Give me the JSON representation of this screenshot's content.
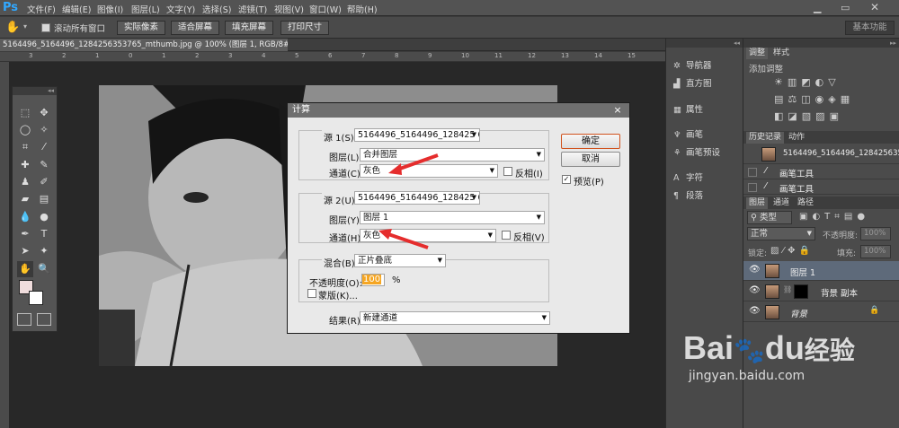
{
  "menubar": {
    "logo": "Ps",
    "items": [
      "文件(F)",
      "编辑(E)",
      "图像(I)",
      "图层(L)",
      "文字(Y)",
      "选择(S)",
      "滤镜(T)",
      "视图(V)",
      "窗口(W)",
      "帮助(H)"
    ]
  },
  "options": {
    "scroll_all": "滚动所有窗口",
    "buttons": [
      "实际像素",
      "适合屏幕",
      "填充屏幕",
      "打印尺寸"
    ],
    "workspace": "基本功能"
  },
  "document": {
    "tab": "5164496_5164496_1284256353765_mthumb.jpg @ 100% (图层 1, RGB/8#) *",
    "close": "×"
  },
  "ruler": {
    "labels": [
      "3",
      "2",
      "1",
      "0",
      "1",
      "2",
      "3",
      "4",
      "5",
      "6",
      "7",
      "8",
      "9",
      "10",
      "11",
      "12",
      "13",
      "14",
      "15"
    ]
  },
  "dialog": {
    "title": "计算",
    "close": "×",
    "source1": {
      "label": "源 1(S):",
      "value": "5164496_5164496_128425 6...",
      "layer_label": "图层(L):",
      "layer": "合并图层",
      "channel_label": "通道(C):",
      "channel": "灰色",
      "invert": "反相(I)"
    },
    "source2": {
      "label": "源 2(U):",
      "value": "5164496_5164496_128425 6...",
      "layer_label": "图层(Y):",
      "layer": "图层 1",
      "channel_label": "通道(H):",
      "channel": "灰色",
      "invert": "反相(V)"
    },
    "blend": {
      "label": "混合(B):",
      "value": "正片叠底",
      "opacity_label": "不透明度(O):",
      "opacity": "100",
      "unit": "%",
      "mask": "蒙版(K)..."
    },
    "result": {
      "label": "结果(R):",
      "value": "新建通道"
    },
    "ok": "确定",
    "cancel": "取消",
    "preview": "预览(P)"
  },
  "side_panel": {
    "items": [
      "导航器",
      "直方图",
      "属性",
      "画笔",
      "画笔预设",
      "字符",
      "段落"
    ]
  },
  "adjust": {
    "tabs": [
      "调整",
      "样式"
    ],
    "add": "添加调整"
  },
  "history": {
    "tabs": [
      "历史记录",
      "动作"
    ],
    "snapshot": "5164496_5164496_1284256353765...",
    "items": [
      "画笔工具",
      "画笔工具"
    ]
  },
  "layers": {
    "tabs": [
      "图层",
      "通道",
      "路径"
    ],
    "kind": "类型",
    "mode": "正常",
    "opacity_label": "不透明度:",
    "opacity": "100%",
    "lock_label": "锁定:",
    "fill_label": "填充:",
    "fill": "100%",
    "rows": [
      "图层 1",
      "背景 副本",
      "背景"
    ]
  },
  "watermark": {
    "brand": "Bai",
    "brand2": "du",
    "cn": "经验",
    "url": "jingyan.baidu.com"
  }
}
